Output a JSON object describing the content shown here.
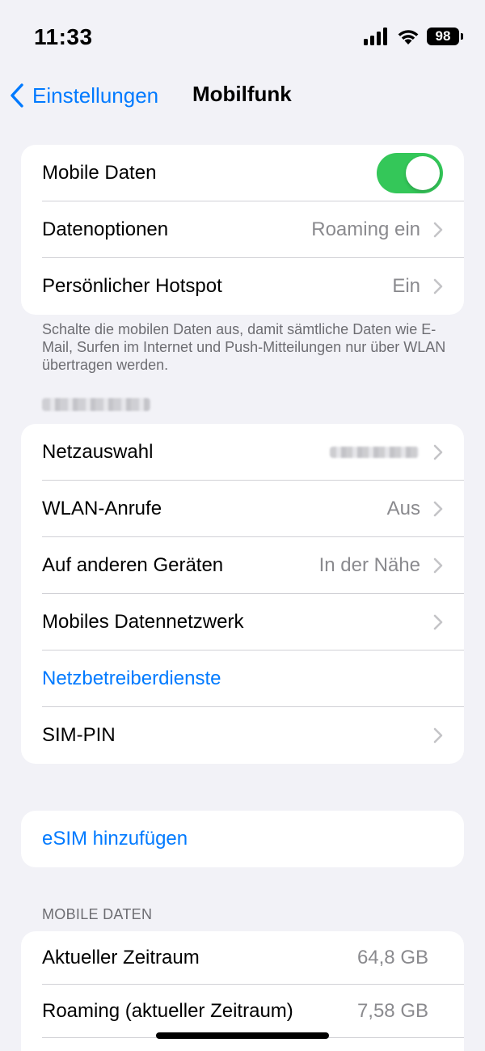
{
  "status_bar": {
    "time": "11:33",
    "battery": "98",
    "icons": [
      "signal-icon",
      "wifi-icon",
      "battery-icon"
    ]
  },
  "nav": {
    "back_label": "Einstellungen",
    "title": "Mobilfunk"
  },
  "group1": {
    "mobile_data": {
      "label": "Mobile Daten",
      "toggle_on": true
    },
    "data_options": {
      "label": "Datenoptionen",
      "value": "Roaming ein"
    },
    "hotspot": {
      "label": "Persönlicher Hotspot",
      "value": "Ein"
    }
  },
  "footnote": "Schalte die mobilen Daten aus, damit sämtliche Daten wie E-Mail, Surfen im Internet und Push-Mitteilungen nur über WLAN übertragen werden.",
  "group2": {
    "network_selection": {
      "label": "Netzauswahl"
    },
    "wifi_calls": {
      "label": "WLAN-Anrufe",
      "value": "Aus"
    },
    "other_devices": {
      "label": "Auf anderen Geräten",
      "value": "In der Nähe"
    },
    "mobile_data_network": {
      "label": "Mobiles Datennetzwerk"
    },
    "carrier_services": {
      "label": "Netzbetreiberdienste"
    },
    "sim_pin": {
      "label": "SIM-PIN"
    }
  },
  "esim": {
    "label": "eSIM hinzufügen"
  },
  "mobile_data_section": {
    "header": "MOBILE DATEN",
    "current_period": {
      "label": "Aktueller Zeitraum",
      "value": "64,8 GB"
    },
    "roaming_period": {
      "label": "Roaming (aktueller Zeitraum)",
      "value": "7,58 GB"
    }
  },
  "colors": {
    "accent": "#007aff",
    "toggle_on": "#34c759",
    "background": "#f2f2f7",
    "secondary_text": "#8a8a8e"
  }
}
